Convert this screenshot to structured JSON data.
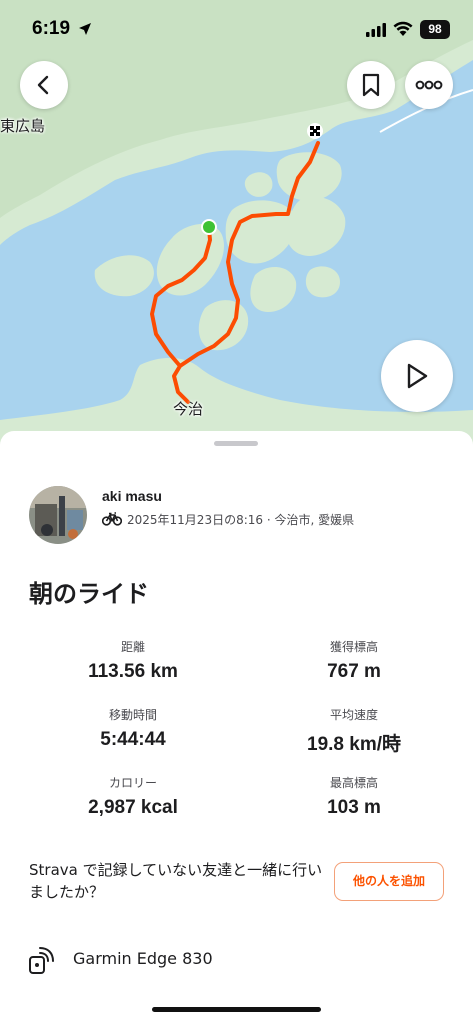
{
  "status_bar": {
    "time": "6:19",
    "battery": "98"
  },
  "map": {
    "labels": {
      "higashihiroshima": "東広島",
      "imabari": "今治"
    },
    "route_color": "#fc4c02",
    "start_marker_color": "#3ec234"
  },
  "athlete": {
    "name": "aki masu",
    "activity_meta": "2025年11月23日の8:16 · 今治市, 愛媛県",
    "sport_icon": "bike-icon"
  },
  "activity": {
    "title": "朝のライド"
  },
  "stats": {
    "distance": {
      "label": "距離",
      "value": "113.56 km"
    },
    "elevation_gain": {
      "label": "獲得標高",
      "value": "767 m"
    },
    "moving_time": {
      "label": "移動時間",
      "value": "5:44:44"
    },
    "avg_speed": {
      "label": "平均速度",
      "value": "19.8 km/時"
    },
    "calories": {
      "label": "カロリー",
      "value": "2,987 kcal"
    },
    "max_elevation": {
      "label": "最高標高",
      "value": "103 m"
    }
  },
  "add_people": {
    "prompt": "Strava で記録していない友達と一緒に行いましたか？",
    "button_label": "他の人を追加"
  },
  "device": {
    "name": "Garmin Edge 830"
  },
  "colors": {
    "accent": "#fc5200",
    "water": "#a9d3ee",
    "land": "#d8ecd6"
  }
}
